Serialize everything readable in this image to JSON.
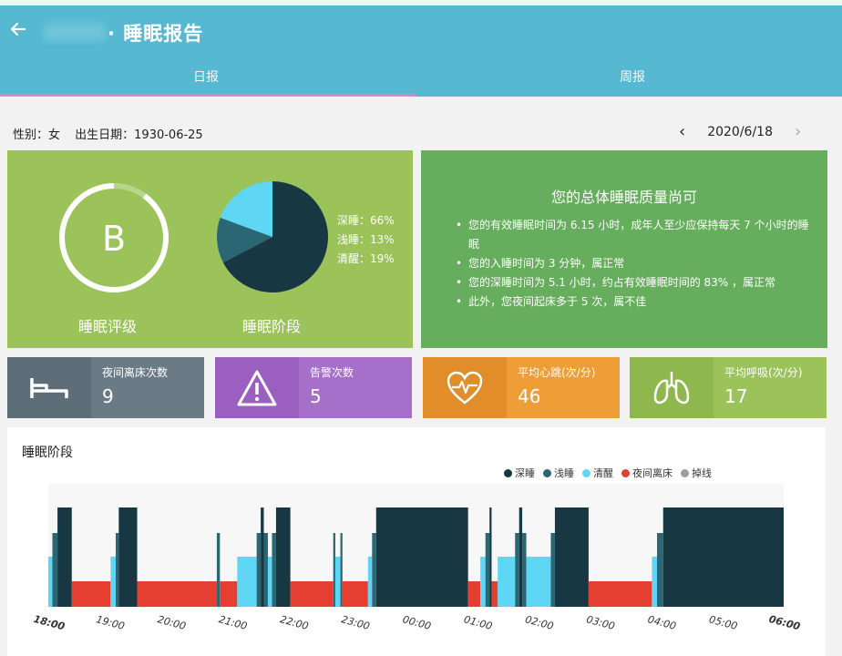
{
  "header": {
    "back_icon": "arrow-left-icon",
    "title": "· 睡眠报告",
    "tabs": [
      {
        "label": "日报",
        "active": true
      },
      {
        "label": "周报",
        "active": false
      }
    ]
  },
  "info": {
    "gender": "性别：女",
    "birth": "出生日期：1930-06-25"
  },
  "date_nav": {
    "prev": "‹",
    "date": "2020/6/18",
    "next": "›"
  },
  "grade": {
    "letter": "B",
    "label": "睡眠评级",
    "ring_fraction": 0.9
  },
  "stages": {
    "label": "睡眠阶段",
    "legend": [
      "深睡：66%",
      "浅睡：13%",
      "清醒：19%"
    ],
    "slices": [
      {
        "name": "深睡",
        "percent": 66,
        "color": "#173843"
      },
      {
        "name": "浅睡",
        "percent": 13,
        "color": "#2b6674"
      },
      {
        "name": "清醒",
        "percent": 19,
        "color": "#5fd6f3"
      }
    ]
  },
  "quality": {
    "title": "您的总体睡眠质量尚可",
    "items": [
      "您的有效睡眠时间为 6.15 小时，成年人至少应保持每天 7 个小时的睡眠",
      "您的入睡时间为 3 分钟，属正常",
      "您的深睡时间为 5.1 小时，约占有效睡眠时间的 83% ，属正常",
      "此外，您夜间起床多于 5 次，属不佳"
    ]
  },
  "tiles": [
    {
      "icon": "bed-icon",
      "label": "夜间离床次数",
      "value": "9"
    },
    {
      "icon": "warning-icon",
      "label": "告警次数",
      "value": "5"
    },
    {
      "icon": "heart-rate-icon",
      "label": "平均心跳(次/分)",
      "value": "46"
    },
    {
      "icon": "lungs-icon",
      "label": "平均呼吸(次/分)",
      "value": "17"
    }
  ],
  "chart_data": {
    "type": "bar",
    "title": "睡眠阶段",
    "x_range": [
      "18:00",
      "06:00"
    ],
    "x_ticks": [
      "18:00",
      "19:00",
      "20:00",
      "21:00",
      "22:00",
      "23:00",
      "00:00",
      "01:00",
      "02:00",
      "03:00",
      "04:00",
      "05:00",
      "06:00"
    ],
    "levels": {
      "深睡": 4,
      "浅睡": 3,
      "清醒": 2,
      "夜间离床": 1
    },
    "series": [
      {
        "name": "深睡",
        "color": "#173843"
      },
      {
        "name": "浅睡",
        "color": "#2b6674"
      },
      {
        "name": "清醒",
        "color": "#5fd6f3"
      },
      {
        "name": "夜间离床",
        "color": "#e53f32"
      },
      {
        "name": "掉线",
        "color": "#9e9e9e"
      }
    ],
    "segments": [
      {
        "start": "18:00",
        "end": "18:04",
        "stage": "清醒"
      },
      {
        "start": "18:04",
        "end": "18:09",
        "stage": "浅睡"
      },
      {
        "start": "18:09",
        "end": "18:23",
        "stage": "深睡"
      },
      {
        "start": "18:23",
        "end": "19:01",
        "stage": "夜间离床"
      },
      {
        "start": "19:01",
        "end": "19:06",
        "stage": "清醒"
      },
      {
        "start": "19:06",
        "end": "19:09",
        "stage": "浅睡"
      },
      {
        "start": "19:09",
        "end": "19:27",
        "stage": "深睡"
      },
      {
        "start": "19:27",
        "end": "20:45",
        "stage": "夜间离床"
      },
      {
        "start": "20:45",
        "end": "20:48",
        "stage": "浅睡"
      },
      {
        "start": "20:48",
        "end": "21:05",
        "stage": "夜间离床"
      },
      {
        "start": "21:05",
        "end": "21:24",
        "stage": "清醒"
      },
      {
        "start": "21:24",
        "end": "21:28",
        "stage": "浅睡"
      },
      {
        "start": "21:28",
        "end": "21:31",
        "stage": "深睡"
      },
      {
        "start": "21:31",
        "end": "21:35",
        "stage": "浅睡"
      },
      {
        "start": "21:35",
        "end": "21:39",
        "stage": "清醒"
      },
      {
        "start": "21:39",
        "end": "21:43",
        "stage": "浅睡"
      },
      {
        "start": "21:43",
        "end": "21:57",
        "stage": "深睡"
      },
      {
        "start": "21:57",
        "end": "22:39",
        "stage": "夜间离床"
      },
      {
        "start": "22:39",
        "end": "22:41",
        "stage": "浅睡"
      },
      {
        "start": "22:41",
        "end": "22:46",
        "stage": "清醒"
      },
      {
        "start": "22:46",
        "end": "22:48",
        "stage": "浅睡"
      },
      {
        "start": "22:48",
        "end": "23:13",
        "stage": "夜间离床"
      },
      {
        "start": "23:13",
        "end": "23:17",
        "stage": "清醒"
      },
      {
        "start": "23:17",
        "end": "23:21",
        "stage": "浅睡"
      },
      {
        "start": "23:21",
        "end": "00:51",
        "stage": "深睡"
      },
      {
        "start": "00:51",
        "end": "01:03",
        "stage": "夜间离床"
      },
      {
        "start": "01:03",
        "end": "01:08",
        "stage": "清醒"
      },
      {
        "start": "01:08",
        "end": "01:12",
        "stage": "浅睡"
      },
      {
        "start": "01:12",
        "end": "01:14",
        "stage": "深睡"
      },
      {
        "start": "01:14",
        "end": "01:20",
        "stage": "夜间离床"
      },
      {
        "start": "01:20",
        "end": "01:37",
        "stage": "清醒"
      },
      {
        "start": "01:37",
        "end": "01:41",
        "stage": "浅睡"
      },
      {
        "start": "01:41",
        "end": "01:44",
        "stage": "深睡"
      },
      {
        "start": "01:44",
        "end": "01:48",
        "stage": "浅睡"
      },
      {
        "start": "01:48",
        "end": "02:12",
        "stage": "清醒"
      },
      {
        "start": "02:12",
        "end": "02:16",
        "stage": "浅睡"
      },
      {
        "start": "02:16",
        "end": "02:49",
        "stage": "深睡"
      },
      {
        "start": "02:49",
        "end": "03:51",
        "stage": "夜间离床"
      },
      {
        "start": "03:51",
        "end": "03:56",
        "stage": "清醒"
      },
      {
        "start": "03:56",
        "end": "04:02",
        "stage": "浅睡"
      },
      {
        "start": "04:02",
        "end": "06:00",
        "stage": "深睡"
      }
    ]
  }
}
